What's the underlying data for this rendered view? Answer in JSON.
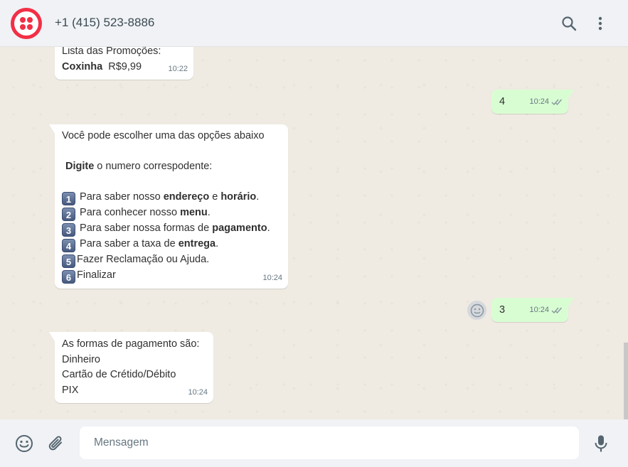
{
  "header": {
    "title": "+1 (415) 523-8886",
    "logo_icon": "twilio-logo",
    "search_icon": "search-icon",
    "menu_icon": "kebab-menu-icon"
  },
  "colors": {
    "brand": "#f22f46",
    "incoming_bubble": "#ffffff",
    "outgoing_bubble": "#d9fdd3",
    "chat_background": "#efeae2",
    "bar_background": "#f0f2f5"
  },
  "messages": {
    "m1": {
      "direction": "incoming",
      "line1": "Lista das Promoções:",
      "item_name": "Coxinha",
      "item_price": "R$9,99",
      "time": "10:22"
    },
    "m2": {
      "direction": "outgoing",
      "text": "4",
      "time": "10:24",
      "status": "read"
    },
    "m3": {
      "direction": "incoming",
      "intro": "Você pode escolher uma das opções abaixo",
      "prompt_bold": "Digite",
      "prompt_rest": " o numero correspodente:",
      "options": [
        {
          "key": "1",
          "a": " Para saber nosso ",
          "b": "endereço",
          "c": " e ",
          "d": "horário",
          "e": "."
        },
        {
          "key": "2",
          "a": " Para conhecer nosso ",
          "b": "menu",
          "c": "."
        },
        {
          "key": "3",
          "a": " Para saber nossa formas de ",
          "b": "pagamento",
          "c": "."
        },
        {
          "key": "4",
          "a": " Para saber a taxa de ",
          "b": "entrega",
          "c": "."
        },
        {
          "key": "5",
          "a": "Fazer Reclamação ou Ajuda."
        },
        {
          "key": "6",
          "a": "Finalizar"
        }
      ],
      "time": "10:24"
    },
    "m4": {
      "direction": "outgoing",
      "text": "3",
      "time": "10:24",
      "status": "read",
      "emoji_icon": "smiley-icon"
    },
    "m5": {
      "direction": "incoming",
      "lines": [
        "As formas de pagamento são:",
        "Dinheiro",
        "Cartão de Crétido/Débito",
        "PIX"
      ],
      "time": "10:24"
    }
  },
  "composer": {
    "placeholder": "Mensagem",
    "emoji_icon": "smiley-icon",
    "attach_icon": "paperclip-icon",
    "mic_icon": "microphone-icon"
  }
}
